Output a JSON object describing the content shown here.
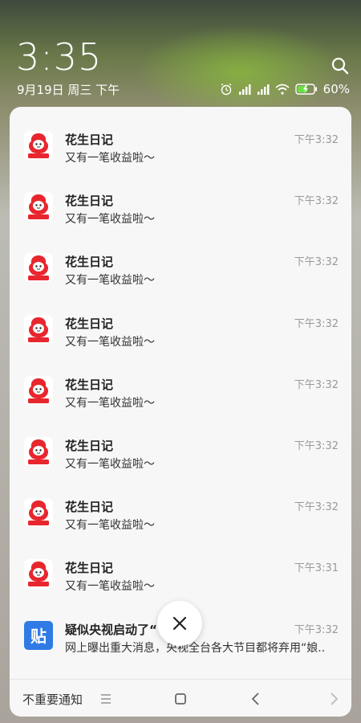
{
  "status": {
    "time": "3:35",
    "date": "9月19日 周三 下午",
    "battery": "60%"
  },
  "notifications": [
    {
      "app": "花生日记",
      "message": "又有一笔收益啦～",
      "time": "下午3:32",
      "icon": "peanut-diary-icon"
    },
    {
      "app": "花生日记",
      "message": "又有一笔收益啦～",
      "time": "下午3:32",
      "icon": "peanut-diary-icon"
    },
    {
      "app": "花生日记",
      "message": "又有一笔收益啦～",
      "time": "下午3:32",
      "icon": "peanut-diary-icon"
    },
    {
      "app": "花生日记",
      "message": "又有一笔收益啦～",
      "time": "下午3:32",
      "icon": "peanut-diary-icon"
    },
    {
      "app": "花生日记",
      "message": "又有一笔收益啦～",
      "time": "下午3:32",
      "icon": "peanut-diary-icon"
    },
    {
      "app": "花生日记",
      "message": "又有一笔收益啦～",
      "time": "下午3:32",
      "icon": "peanut-diary-icon"
    },
    {
      "app": "花生日记",
      "message": "又有一笔收益啦～",
      "time": "下午3:32",
      "icon": "peanut-diary-icon"
    },
    {
      "app": "花生日记",
      "message": "又有一笔收益啦～",
      "time": "下午3:31",
      "icon": "peanut-diary-icon"
    },
    {
      "app": "疑似央视启动了“      ”？",
      "message": "网上曝出重大消息，央视全台各大节目都将弃用“娘..",
      "time": "下午3:32",
      "icon": "tieba-icon"
    }
  ],
  "tieba_icon_text": "贴",
  "bottom": {
    "unimportant_label": "不重要通知"
  },
  "colors": {
    "panel_bg": "#f7f7f7",
    "peanut_red": "#e8262d",
    "tieba_blue": "#2f7ae5"
  }
}
